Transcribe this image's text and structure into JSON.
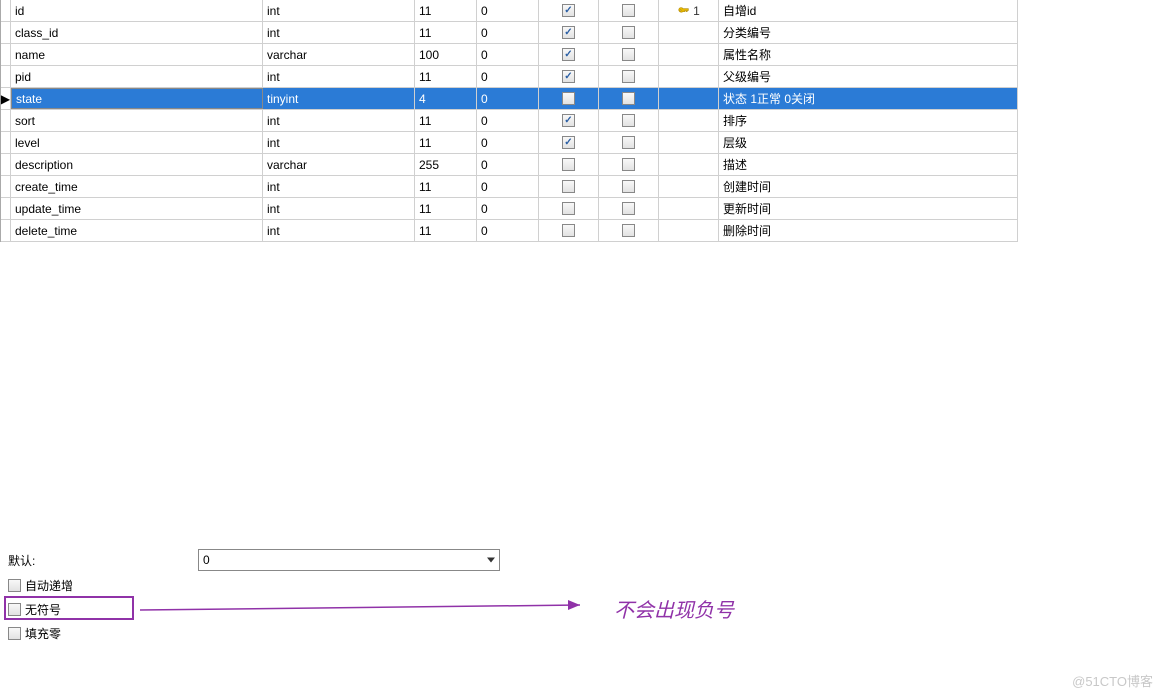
{
  "rows": [
    {
      "indicator": "",
      "name": "id",
      "type": "int",
      "len": "11",
      "dec": "0",
      "chk1": true,
      "chk2": false,
      "key": "1",
      "comment": "自增id",
      "selected": false
    },
    {
      "indicator": "",
      "name": "class_id",
      "type": "int",
      "len": "11",
      "dec": "0",
      "chk1": true,
      "chk2": false,
      "key": "",
      "comment": "分类编号",
      "selected": false
    },
    {
      "indicator": "",
      "name": "name",
      "type": "varchar",
      "len": "100",
      "dec": "0",
      "chk1": true,
      "chk2": false,
      "key": "",
      "comment": "属性名称",
      "selected": false
    },
    {
      "indicator": "",
      "name": "pid",
      "type": "int",
      "len": "11",
      "dec": "0",
      "chk1": true,
      "chk2": false,
      "key": "",
      "comment": "父级编号",
      "selected": false
    },
    {
      "indicator": "▶",
      "name": "state",
      "type": "tinyint",
      "len": "4",
      "dec": "0",
      "chk1": false,
      "chk2": false,
      "key": "",
      "comment": "状态    1正常  0关闭",
      "selected": true
    },
    {
      "indicator": "",
      "name": "sort",
      "type": "int",
      "len": "11",
      "dec": "0",
      "chk1": true,
      "chk2": false,
      "key": "",
      "comment": "排序",
      "selected": false
    },
    {
      "indicator": "",
      "name": "level",
      "type": "int",
      "len": "11",
      "dec": "0",
      "chk1": true,
      "chk2": false,
      "key": "",
      "comment": "层级",
      "selected": false
    },
    {
      "indicator": "",
      "name": "description",
      "type": "varchar",
      "len": "255",
      "dec": "0",
      "chk1": false,
      "chk2": false,
      "key": "",
      "comment": "描述",
      "selected": false
    },
    {
      "indicator": "",
      "name": "create_time",
      "type": "int",
      "len": "11",
      "dec": "0",
      "chk1": false,
      "chk2": false,
      "key": "",
      "comment": "创建时间",
      "selected": false
    },
    {
      "indicator": "",
      "name": "update_time",
      "type": "int",
      "len": "11",
      "dec": "0",
      "chk1": false,
      "chk2": false,
      "key": "",
      "comment": "更新时间",
      "selected": false
    },
    {
      "indicator": "",
      "name": "delete_time",
      "type": "int",
      "len": "11",
      "dec": "0",
      "chk1": false,
      "chk2": false,
      "key": "",
      "comment": "删除时间",
      "selected": false
    }
  ],
  "bottom": {
    "default_label": "默认:",
    "default_value": "0",
    "auto_increment": "自动递增",
    "unsigned": "无符号",
    "zerofill": "填充零"
  },
  "annotation": "不会出现负号",
  "watermark": "@51CTO博客"
}
